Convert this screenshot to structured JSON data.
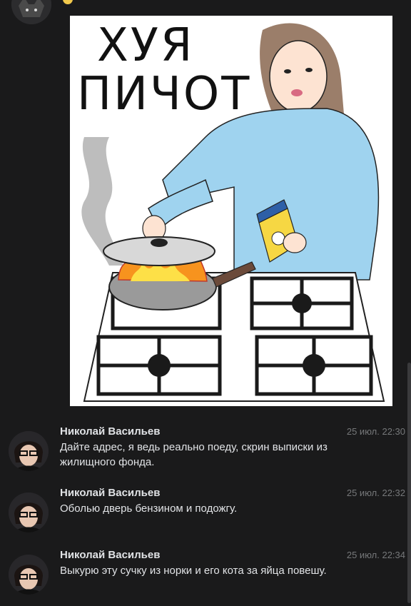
{
  "caption": {
    "line1": "ХУЯ",
    "line2": "ПИЧОТ"
  },
  "messages": [
    {
      "author": "Николай Васильев",
      "time": "25 июл. 22:30",
      "text": "Дайте адрес, я ведь реально поеду, скрин выписки из жилищного фонда."
    },
    {
      "author": "Николай Васильев",
      "time": "25 июл. 22:32",
      "text": "Оболью дверь бензином и подожгу."
    },
    {
      "author": "Николай Васильев",
      "time": "25 июл. 22:34",
      "text": "Выкурю эту сучку из норки и его кота за яйца повешу."
    }
  ],
  "colors": {
    "background": "#1a1a1b",
    "text": "#e1e3e6",
    "muted": "#76787a",
    "sweater": "#9fd3ef",
    "flame": "#f7931e"
  }
}
